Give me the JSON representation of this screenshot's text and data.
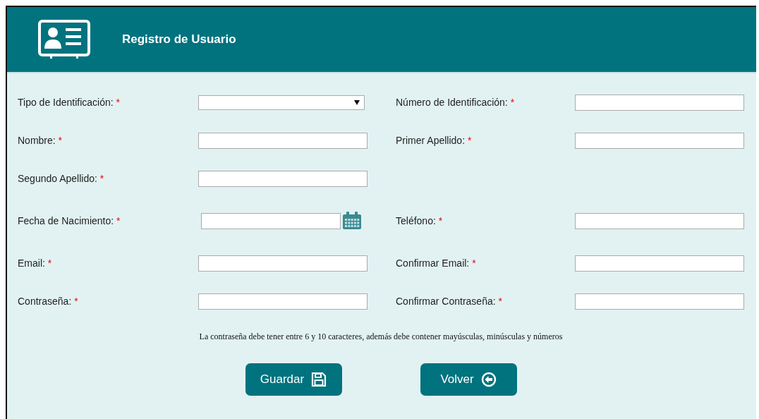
{
  "header": {
    "title": "Registro de Usuario"
  },
  "rows": [
    [
      {
        "kind": "select",
        "label": "Tipo de Identificación:",
        "required_mark": "*"
      },
      {
        "kind": "text",
        "label": "Número de Identificación:",
        "required_mark": "*"
      }
    ],
    [
      {
        "kind": "text",
        "label": "Nombre:",
        "required_mark": "*"
      },
      {
        "kind": "text",
        "label": "Primer Apellido:",
        "required_mark": "*"
      }
    ],
    [
      {
        "kind": "text",
        "label": "Segundo Apellido:",
        "required_mark": "*"
      }
    ],
    [
      {
        "kind": "date",
        "label": "Fecha de Nacimiento:",
        "required_mark": "*"
      },
      {
        "kind": "text",
        "label": "Teléfono:",
        "required_mark": "*"
      }
    ],
    [
      {
        "kind": "text",
        "label": "Email:",
        "required_mark": "*"
      },
      {
        "kind": "text",
        "label": "Confirmar Email:",
        "required_mark": "*"
      }
    ],
    [
      {
        "kind": "text",
        "label": "Contraseña:",
        "required_mark": "*"
      },
      {
        "kind": "text",
        "label": "Confirmar Contraseña:",
        "required_mark": "*"
      }
    ]
  ],
  "note": "La contraseña debe tener entre 6 y 10 caracteres, además debe contener mayúsculas, minúsculas y números",
  "buttons": [
    {
      "kind": "save",
      "label": "Guardar"
    },
    {
      "kind": "back",
      "label": "Volver"
    }
  ]
}
